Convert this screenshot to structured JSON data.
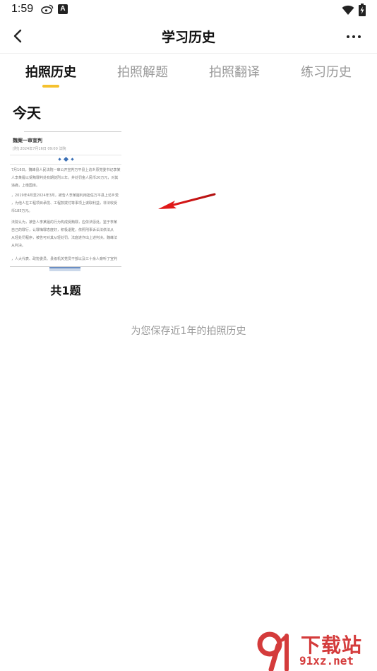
{
  "status_bar": {
    "time": "1:59",
    "app_badge": "A",
    "icons": [
      "weibo-icon",
      "app-a-icon",
      "wifi-icon",
      "battery-charging-icon"
    ]
  },
  "header": {
    "title": "学习历史",
    "back_icon": "chevron-left-icon",
    "more_icon": "more-dots-icon"
  },
  "tabs": [
    {
      "label": "拍照历史",
      "active": true
    },
    {
      "label": "拍照解题",
      "active": false
    },
    {
      "label": "拍照翻译",
      "active": false
    },
    {
      "label": "练习历史",
      "active": false
    }
  ],
  "colors": {
    "accent": "#f5c12e",
    "watermark": "#d43b3b",
    "inactive_tab": "#999999"
  },
  "section": {
    "title": "今天"
  },
  "history_item": {
    "doc_headline": "魏案一审宣判",
    "doc_meta": "[附] 2024年7月16日 09:00 法院",
    "paragraphs": [
      [
        "7月16日，魏峰县人民法院一审公开宣判万平县上访乡原党委书记李某",
        "人李某履以受贿罪判处有期徒刑三年，并处罚金人民币20万元，对其",
        "违痛，上缴国库。"
      ],
      [
        "，2019年4月至2024年3月，被告人李某履利用担任万平县上访乡党",
        "，为他人在工程项目承揽、工程款拨付等事项上谋取利益，非法收受",
        "币185万元。"
      ],
      [
        "法院认为，被告人李某履的行为构成受贿罪，应依法惩处。鉴于李某",
        "自己的罪行，认罪悔罪态度好，积极退赃，依照刑事诉讼法依法从",
        "从轻处罚程序，被告可对其从轻处罚。法庭遂作出上述判决。魏峰法",
        "从判决。"
      ],
      [
        "，人大代表、政协委员、县级机关党员干部以及三十余人旁听了宣判"
      ]
    ],
    "count_label": "共1题"
  },
  "footer": {
    "note": "为您保存近1年的拍照历史"
  },
  "watermark": {
    "brand": "下载站",
    "url": "91xz.net",
    "logo_icon": "9-logo-icon"
  }
}
